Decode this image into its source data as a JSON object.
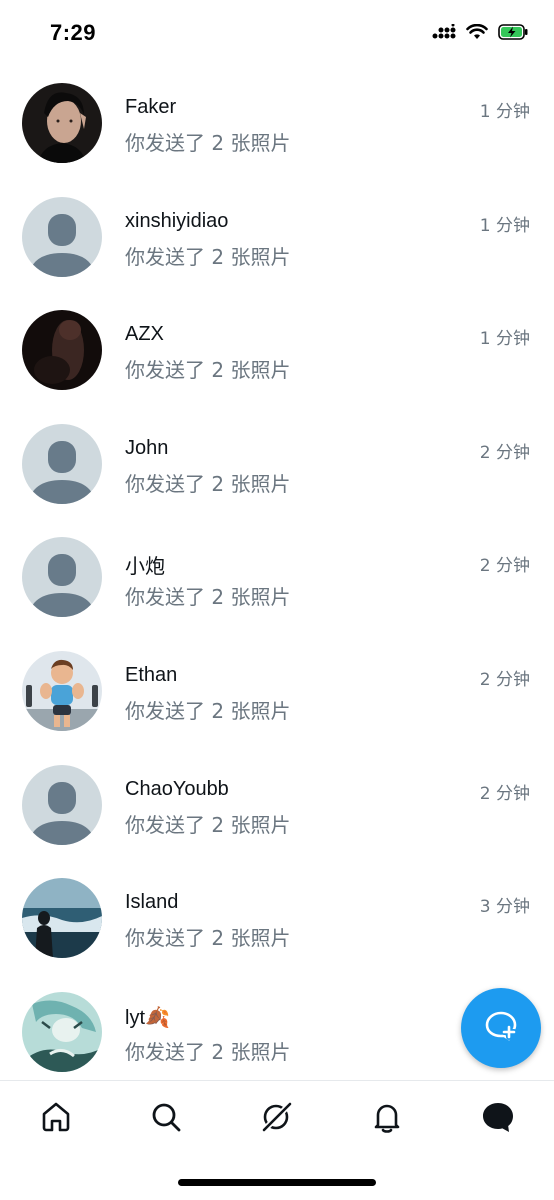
{
  "status_bar": {
    "time": "7:29"
  },
  "conversations": [
    {
      "name": "Faker",
      "preview": "你发送了 2 张照片",
      "time": "1 分钟",
      "avatar": "photo-man"
    },
    {
      "name": "xinshiyidiao",
      "preview": "你发送了 2 张照片",
      "time": "1 分钟",
      "avatar": "default-avatar"
    },
    {
      "name": "AZX",
      "preview": "你发送了 2 张照片",
      "time": "1 分钟",
      "avatar": "dark-photo"
    },
    {
      "name": "John",
      "preview": "你发送了 2 张照片",
      "time": "2 分钟",
      "avatar": "default-avatar"
    },
    {
      "name": "小炮",
      "preview": "你发送了 2 张照片",
      "time": "2 分钟",
      "avatar": "default-avatar"
    },
    {
      "name": "Ethan",
      "preview": "你发送了 2 张照片",
      "time": "2 分钟",
      "avatar": "cartoon-gym"
    },
    {
      "name": "ChaoYoubb",
      "preview": "你发送了 2 张照片",
      "time": "2 分钟",
      "avatar": "default-avatar"
    },
    {
      "name": "Island",
      "preview": "你发送了 2 张照片",
      "time": "3 分钟",
      "avatar": "sea-photo"
    },
    {
      "name": "lyt🍂",
      "preview": "你发送了 2 张照片",
      "time": "",
      "avatar": "anime-art"
    }
  ],
  "tab_bar": {
    "items": [
      "home-icon",
      "search-icon",
      "grok-icon",
      "notifications-icon",
      "messages-icon"
    ],
    "active": "messages-icon"
  },
  "fab": {
    "icon": "new-message-icon"
  },
  "colors": {
    "accent": "#1d9bf0",
    "secondary_text": "#6b7680",
    "default_avatar_bg": "#cfd9de",
    "default_avatar_fg": "#687b8a"
  }
}
